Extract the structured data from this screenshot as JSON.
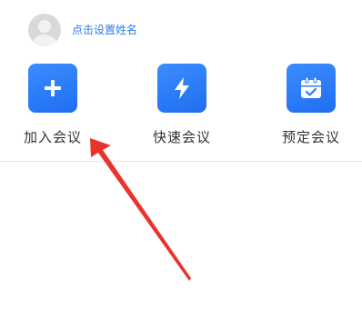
{
  "profile": {
    "name_prompt": "点击设置姓名"
  },
  "actions": [
    {
      "label": "加入会议",
      "icon": "plus-icon"
    },
    {
      "label": "快速会议",
      "icon": "lightning-icon"
    },
    {
      "label": "预定会议",
      "icon": "calendar-check-icon"
    }
  ],
  "colors": {
    "accent": "#2f7be6",
    "tile": "#2a7cf7",
    "arrow": "#e8332f"
  }
}
